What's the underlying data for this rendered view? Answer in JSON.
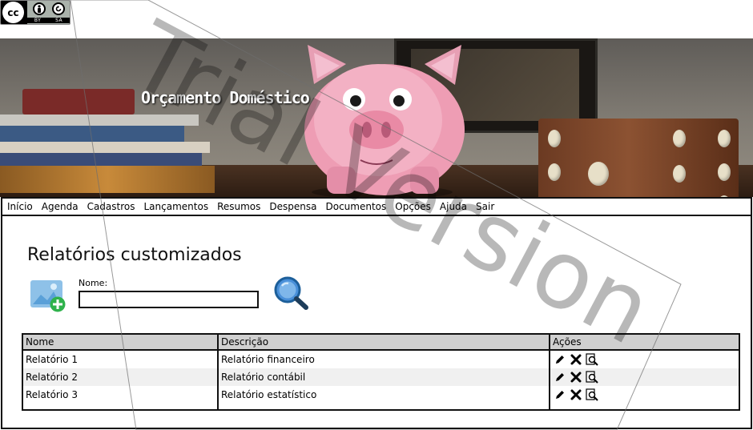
{
  "license_badge": {
    "cc": "cc",
    "by": "BY",
    "sa": "SA"
  },
  "banner": {
    "title": "Orçamento Doméstico"
  },
  "menu": {
    "items": [
      "Início",
      "Agenda",
      "Cadastros",
      "Lançamentos",
      "Resumos",
      "Despensa",
      "Documentos",
      "Opções",
      "Ajuda",
      "Sair"
    ]
  },
  "page": {
    "title": "Relatórios customizados",
    "name_label": "Nome:",
    "name_value": ""
  },
  "table": {
    "headers": [
      "Nome",
      "Descrição",
      "Ações"
    ],
    "rows": [
      {
        "name": "Relatório 1",
        "description": "Relatório financeiro"
      },
      {
        "name": "Relatório 2",
        "description": "Relatório contábil"
      },
      {
        "name": "Relatório 3",
        "description": "Relatório estatístico"
      }
    ],
    "action_icons": [
      "pencil-icon",
      "delete-x-icon",
      "view-document-icon"
    ]
  },
  "watermark": {
    "text": "Trial Version"
  },
  "colors": {
    "header_bg": "#d0d0d0",
    "alt_row": "#f0f0f0",
    "icon_blue": "#4a90d9",
    "icon_green": "#2fb24c"
  }
}
